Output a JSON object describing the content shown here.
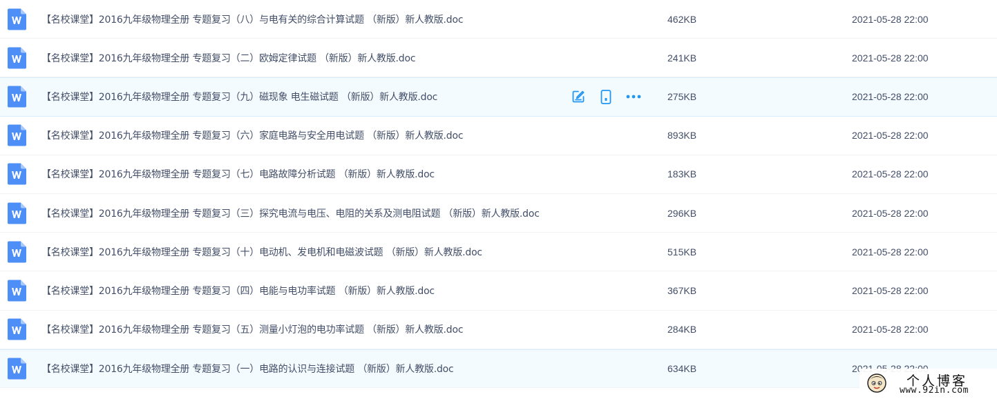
{
  "files": [
    {
      "name": "【名校课堂】2016九年级物理全册 专题复习（八）与电有关的综合计算试题 （新版）新人教版.doc",
      "size": "462KB",
      "date": "2021-05-28 22:00",
      "icon": "word-doc-icon"
    },
    {
      "name": "【名校课堂】2016九年级物理全册 专题复习（二）欧姆定律试题 （新版）新人教版.doc",
      "size": "241KB",
      "date": "2021-05-28 22:00",
      "icon": "word-doc-icon"
    },
    {
      "name": "【名校课堂】2016九年级物理全册 专题复习（九）磁现象 电生磁试题 （新版）新人教版.doc",
      "size": "275KB",
      "date": "2021-05-28 22:00",
      "icon": "word-doc-icon",
      "hovered": true
    },
    {
      "name": "【名校课堂】2016九年级物理全册 专题复习（六）家庭电路与安全用电试题 （新版）新人教版.doc",
      "size": "893KB",
      "date": "2021-05-28 22:00",
      "icon": "word-doc-icon"
    },
    {
      "name": "【名校课堂】2016九年级物理全册 专题复习（七）电路故障分析试题 （新版）新人教版.doc",
      "size": "183KB",
      "date": "2021-05-28 22:00",
      "icon": "word-doc-icon"
    },
    {
      "name": "【名校课堂】2016九年级物理全册 专题复习（三）探究电流与电压、电阻的关系及测电阻试题 （新版）新人教版.doc",
      "size": "296KB",
      "date": "2021-05-28 22:00",
      "icon": "word-doc-icon"
    },
    {
      "name": "【名校课堂】2016九年级物理全册 专题复习（十）电动机、发电机和电磁波试题 （新版）新人教版.doc",
      "size": "515KB",
      "date": "2021-05-28 22:00",
      "icon": "word-doc-icon"
    },
    {
      "name": "【名校课堂】2016九年级物理全册 专题复习（四）电能与电功率试题 （新版）新人教版.doc",
      "size": "367KB",
      "date": "2021-05-28 22:00",
      "icon": "word-doc-icon"
    },
    {
      "name": "【名校课堂】2016九年级物理全册 专题复习（五）测量小灯泡的电功率试题 （新版）新人教版.doc",
      "size": "284KB",
      "date": "2021-05-28 22:00",
      "icon": "word-doc-icon"
    },
    {
      "name": "【名校课堂】2016九年级物理全册 专题复习（一）电路的认识与连接试题 （新版）新人教版.doc",
      "size": "634KB",
      "date": "2021-05-28 22:00",
      "icon": "word-doc-icon"
    }
  ],
  "row_actions": [
    {
      "name": "edit-icon"
    },
    {
      "name": "phone-icon"
    },
    {
      "name": "more-icon"
    }
  ],
  "colors": {
    "accent": "#2196f3",
    "word_icon": "#4d8ef7",
    "text": "#424e67",
    "hover_bg": "#f4fbff"
  },
  "watermark": {
    "title": "个人博客",
    "url": "www.92in.com"
  }
}
